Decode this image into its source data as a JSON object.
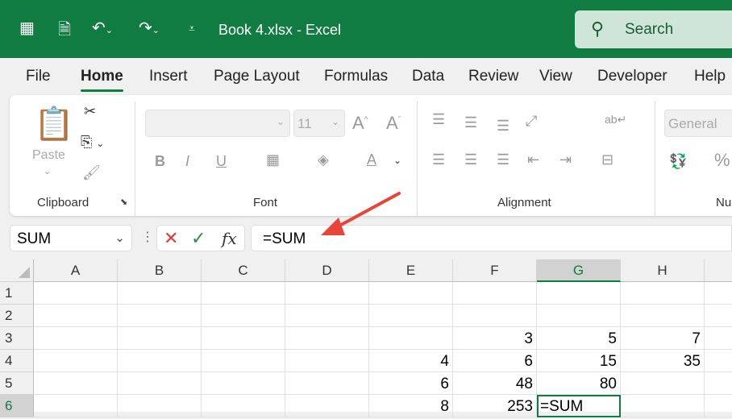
{
  "titlebar": {
    "title": "Book 4.xlsx  -  Excel",
    "search_placeholder": "Search"
  },
  "tabs": [
    "File",
    "Home",
    "Insert",
    "Page Layout",
    "Formulas",
    "Data",
    "Review",
    "View",
    "Developer",
    "Help"
  ],
  "active_tab": "Home",
  "ribbon": {
    "clipboard": {
      "label": "Clipboard",
      "paste": "Paste"
    },
    "font": {
      "label": "Font",
      "font_name": "",
      "font_size": "11",
      "bold": "B",
      "italic": "I",
      "underline": "U",
      "font_color": "A"
    },
    "alignment": {
      "label": "Alignment"
    },
    "number": {
      "label": "Nu",
      "format": "General",
      "percent": "%"
    }
  },
  "formula_bar": {
    "name_box": "SUM",
    "fx": "fx",
    "value": "=SUM"
  },
  "columns": [
    "A",
    "B",
    "C",
    "D",
    "E",
    "F",
    "G",
    "H"
  ],
  "selected_column": "G",
  "rows": [
    {
      "n": "1",
      "cells": {}
    },
    {
      "n": "2",
      "cells": {}
    },
    {
      "n": "3",
      "cells": {
        "F": "3",
        "G": "5",
        "H": "7"
      }
    },
    {
      "n": "4",
      "cells": {
        "E": "4",
        "F": "6",
        "G": "15",
        "H": "35"
      }
    },
    {
      "n": "5",
      "cells": {
        "E": "6",
        "F": "48",
        "G": "80"
      }
    },
    {
      "n": "6",
      "cells": {
        "E": "8",
        "F": "253",
        "G": "=SUM"
      }
    }
  ],
  "active_cell": "G6",
  "annotation_color": "#e8443a"
}
